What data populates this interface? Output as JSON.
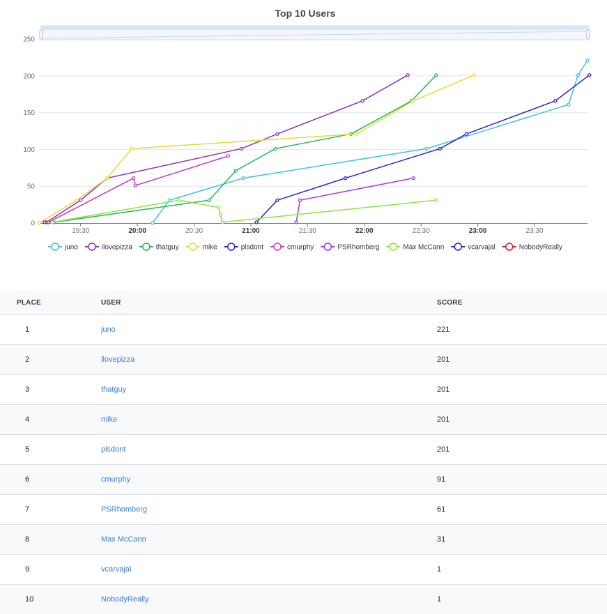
{
  "chart_data": {
    "type": "line",
    "title": "Top 10 Users",
    "xlabel": "",
    "ylabel": "",
    "ylim": [
      0,
      250
    ],
    "yticks": [
      "0",
      "50",
      "100",
      "150",
      "200",
      "250"
    ],
    "x_axis_type": "time",
    "xlim": [
      "19:08",
      "23:58"
    ],
    "xticks": [
      {
        "t": "19:30",
        "label": "19:30",
        "bold": false
      },
      {
        "t": "20:00",
        "label": "20:00",
        "bold": true
      },
      {
        "t": "20:30",
        "label": "20:30",
        "bold": false
      },
      {
        "t": "21:00",
        "label": "21:00",
        "bold": true
      },
      {
        "t": "21:30",
        "label": "21:30",
        "bold": false
      },
      {
        "t": "22:00",
        "label": "22:00",
        "bold": true
      },
      {
        "t": "22:30",
        "label": "22:30",
        "bold": false
      },
      {
        "t": "23:00",
        "label": "23:00",
        "bold": true
      },
      {
        "t": "23:30",
        "label": "23:30",
        "bold": false
      }
    ],
    "grid": "horizontal",
    "legend_position": "bottom",
    "has_zoom_slider": true,
    "series": [
      {
        "name": "juno",
        "color": "#3ec0ea",
        "points": [
          [
            "20:08",
            0
          ],
          [
            "20:17",
            31
          ],
          [
            "20:56",
            61
          ],
          [
            "22:33",
            101
          ],
          [
            "23:48",
            161
          ],
          [
            "23:53",
            201
          ],
          [
            "23:58",
            221
          ]
        ]
      },
      {
        "name": "ilovepizza",
        "color": "#8c2fc2",
        "points": [
          [
            "19:12",
            1
          ],
          [
            "19:30",
            31
          ],
          [
            "19:44",
            61
          ],
          [
            "20:55",
            101
          ],
          [
            "21:14",
            121
          ],
          [
            "21:59",
            166
          ],
          [
            "22:23",
            201
          ]
        ]
      },
      {
        "name": "thatguy",
        "color": "#1eba4c",
        "points": [
          [
            "19:16",
            1
          ],
          [
            "20:38",
            31
          ],
          [
            "20:52",
            71
          ],
          [
            "21:13",
            101
          ],
          [
            "21:53",
            121
          ],
          [
            "22:25",
            166
          ],
          [
            "22:38",
            201
          ]
        ]
      },
      {
        "name": "mike",
        "color": "#e8d839",
        "points": [
          [
            "19:08",
            0
          ],
          [
            "19:28",
            31
          ],
          [
            "19:44",
            61
          ],
          [
            "19:57",
            101
          ],
          [
            "21:56",
            121
          ],
          [
            "22:26",
            166
          ],
          [
            "22:58",
            201
          ]
        ]
      },
      {
        "name": "plsdont",
        "color": "#2e1fd6",
        "points": [
          [
            "21:03",
            1
          ],
          [
            "21:14",
            31
          ],
          [
            "21:50",
            61
          ],
          [
            "22:40",
            101
          ],
          [
            "22:54",
            121
          ],
          [
            "23:41",
            166
          ],
          [
            "23:59",
            201
          ]
        ]
      },
      {
        "name": "cmurphy",
        "color": "#c53acb",
        "points": [
          [
            "19:13",
            1
          ],
          [
            "19:58",
            61
          ],
          [
            "19:59",
            51
          ],
          [
            "20:48",
            91
          ]
        ]
      },
      {
        "name": "PSRhomberg",
        "color": "#a035e6",
        "points": [
          [
            "21:24",
            1
          ],
          [
            "21:26",
            31
          ],
          [
            "22:26",
            61
          ]
        ]
      },
      {
        "name": "Max McCann",
        "color": "#88e73b",
        "points": [
          [
            "19:15",
            1
          ],
          [
            "20:22",
            31
          ],
          [
            "20:43",
            21
          ],
          [
            "20:44",
            11
          ],
          [
            "20:45",
            1
          ],
          [
            "22:38",
            31
          ]
        ]
      },
      {
        "name": "vcarvajal",
        "color": "#2e1fd6",
        "points": [
          [
            "19:11",
            1
          ]
        ]
      },
      {
        "name": "NobodyReally",
        "color": "#d91c1c",
        "points": [
          [
            "19:13",
            1
          ]
        ]
      }
    ]
  },
  "table": {
    "headers": {
      "place": "PLACE",
      "user": "USER",
      "score": "SCORE"
    },
    "rows": [
      {
        "place": "1",
        "user": "juno",
        "score": "221"
      },
      {
        "place": "2",
        "user": "ilovepizza",
        "score": "201"
      },
      {
        "place": "3",
        "user": "thatguy",
        "score": "201"
      },
      {
        "place": "4",
        "user": "mike",
        "score": "201"
      },
      {
        "place": "5",
        "user": "plsdont",
        "score": "201"
      },
      {
        "place": "6",
        "user": "cmurphy",
        "score": "91"
      },
      {
        "place": "7",
        "user": "PSRhomberg",
        "score": "61"
      },
      {
        "place": "8",
        "user": "Max McCann",
        "score": "31"
      },
      {
        "place": "9",
        "user": "vcarvajal",
        "score": "1"
      },
      {
        "place": "10",
        "user": "NobodyReally",
        "score": "1"
      }
    ]
  }
}
